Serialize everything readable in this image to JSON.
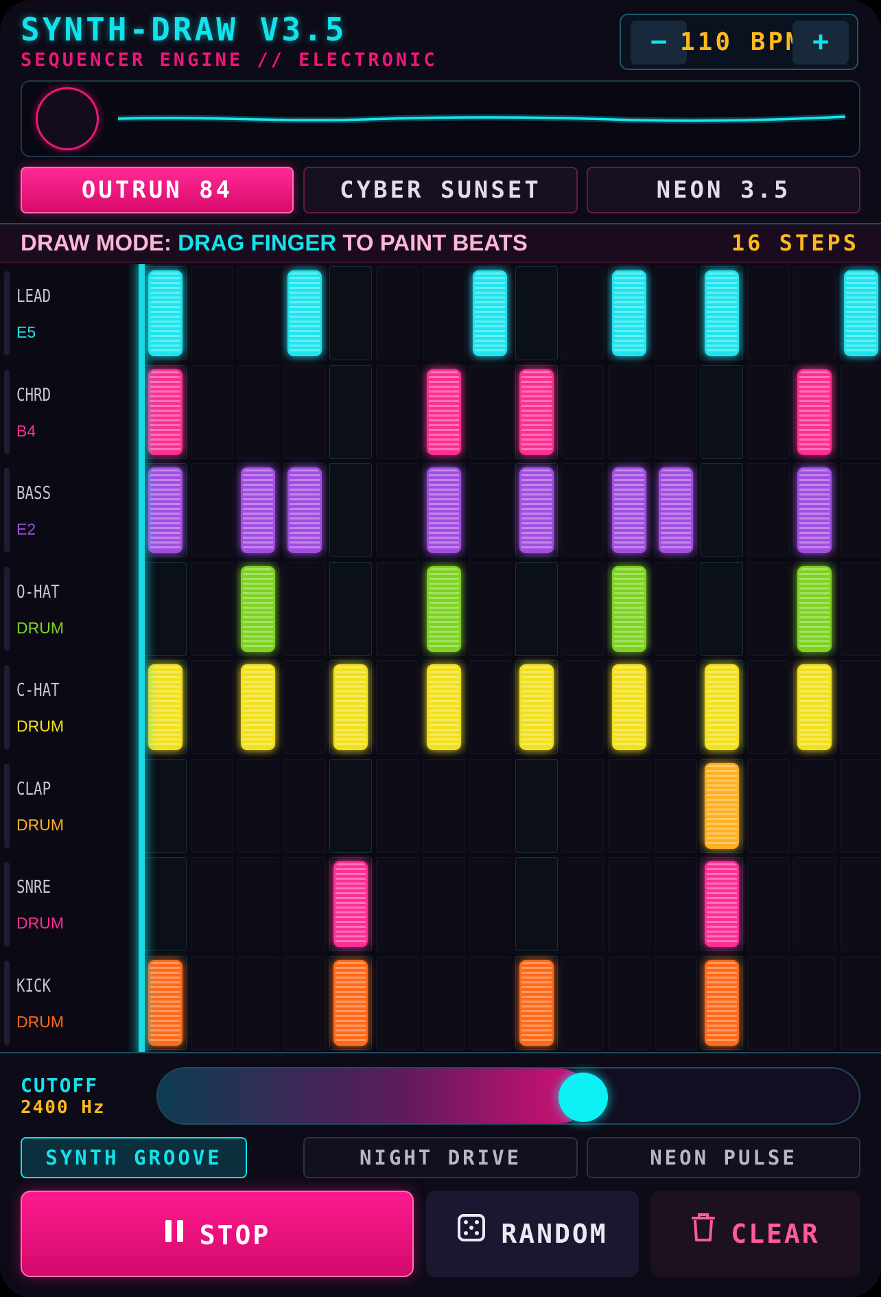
{
  "header": {
    "title": "SYNTH-DRAW V3.5",
    "subtitle": "SEQUENCER ENGINE // ELECTRONIC"
  },
  "bpm": {
    "minus_label": "−",
    "value_label": "110 BPM",
    "plus_label": "+"
  },
  "kits": [
    {
      "label": "OUTRUN 84",
      "active": true
    },
    {
      "label": "CYBER SUNSET",
      "active": false
    },
    {
      "label": "NEON 3.5",
      "active": false
    }
  ],
  "info_bar": {
    "mode_prefix": "DRAW MODE:",
    "mode_action": "DRAG FINGER",
    "mode_suffix": "TO PAINT BEATS",
    "steps_label": "16 STEPS"
  },
  "sequencer": {
    "steps": 16,
    "playhead_step": 0,
    "tracks": [
      {
        "name": "LEAD",
        "note": "E5",
        "color": "#1fe4ef",
        "pattern": [
          1,
          0,
          0,
          1,
          0,
          0,
          0,
          1,
          0,
          0,
          1,
          0,
          1,
          0,
          0,
          1
        ]
      },
      {
        "name": "CHRD",
        "note": "B4",
        "color": "#ff2f92",
        "pattern": [
          1,
          0,
          0,
          0,
          0,
          0,
          1,
          0,
          1,
          0,
          0,
          0,
          0,
          0,
          1,
          0
        ]
      },
      {
        "name": "BASS",
        "note": "E2",
        "color": "#a24ee0",
        "pattern": [
          1,
          0,
          1,
          1,
          0,
          0,
          1,
          0,
          1,
          0,
          1,
          1,
          0,
          0,
          1,
          0
        ]
      },
      {
        "name": "O-HAT",
        "note": "DRUM",
        "color": "#7ed321",
        "pattern": [
          0,
          0,
          1,
          0,
          0,
          0,
          1,
          0,
          0,
          0,
          1,
          0,
          0,
          0,
          1,
          0
        ]
      },
      {
        "name": "C-HAT",
        "note": "DRUM",
        "color": "#f2e01a",
        "pattern": [
          1,
          0,
          1,
          0,
          1,
          0,
          1,
          0,
          1,
          0,
          1,
          0,
          1,
          0,
          1,
          0
        ]
      },
      {
        "name": "CLAP",
        "note": "DRUM",
        "color": "#ffb020",
        "pattern": [
          0,
          0,
          0,
          0,
          0,
          0,
          0,
          0,
          0,
          0,
          0,
          0,
          1,
          0,
          0,
          0
        ]
      },
      {
        "name": "SNRE",
        "note": "DRUM",
        "color": "#ff2e95",
        "pattern": [
          0,
          0,
          0,
          0,
          1,
          0,
          0,
          0,
          0,
          0,
          0,
          0,
          1,
          0,
          0,
          0
        ]
      },
      {
        "name": "KICK",
        "note": "DRUM",
        "color": "#ff6a1a",
        "pattern": [
          1,
          0,
          0,
          0,
          1,
          0,
          0,
          0,
          1,
          0,
          0,
          0,
          1,
          0,
          0,
          0
        ]
      }
    ]
  },
  "cutoff": {
    "label": "CUTOFF",
    "value_label": "2400 Hz",
    "level": 0.61
  },
  "presets": [
    {
      "label": "SYNTH GROOVE",
      "active": true
    },
    {
      "label": "NIGHT DRIVE",
      "active": false
    },
    {
      "label": "NEON PULSE",
      "active": false
    }
  ],
  "actions": {
    "stop_label": "STOP",
    "random_label": "RANDOM",
    "clear_label": "CLEAR"
  },
  "colors": {
    "accent_cyan": "#11e3ec",
    "accent_pink": "#f0157d",
    "accent_amber": "#ffb91e",
    "background": "#0d0b18"
  }
}
